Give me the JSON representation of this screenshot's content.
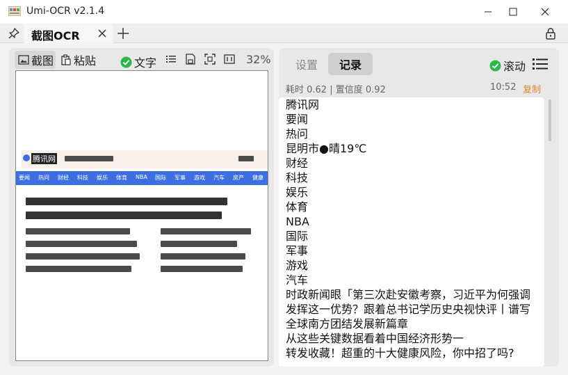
{
  "window": {
    "title": "Umi-OCR v2.1.4",
    "controls": [
      "minimize",
      "maximize",
      "close"
    ]
  },
  "tabs": {
    "items": [
      {
        "label": "截图OCR"
      }
    ],
    "add_icon": "plus-icon",
    "lock_icon": "lock-icon"
  },
  "left": {
    "screenshot_label": "截图",
    "paste_label": "粘贴",
    "text_toggle_label": "文字",
    "text_toggle_checked": true,
    "zoom": "32%",
    "preview": {
      "site": "腾讯网",
      "nav": [
        "要闻",
        "热问",
        "财经",
        "科技",
        "娱乐",
        "体育",
        "NBA",
        "国际",
        "军事",
        "游戏",
        "汽车",
        "房产",
        "健康"
      ]
    }
  },
  "right": {
    "tab_settings": "设置",
    "tab_records": "记录",
    "scroll_label": "滚动",
    "scroll_checked": true,
    "meta": "耗时 0.62 | 置信度 0.92",
    "time": "10:52",
    "copy_label": "复制",
    "lines": [
      "腾讯网",
      "要闻",
      "热问",
      "昆明市●晴19℃",
      "财经",
      "科技",
      "娱乐",
      "体育",
      "NBA",
      "国际",
      "军事",
      "游戏",
      "汽车",
      "时政新闻眼「第三次赴安徽考察，习近平为何强调发挥这一优势？跟着总书记学历史央视快评丨谱写全球南方团结发展新篇章",
      "从这些关键数据看着中国经济形势一",
      "转发收藏！超重的十大健康风险，你中招了吗?"
    ]
  },
  "colors": {
    "accent_green": "#2db64a",
    "copy_orange": "#e08a2a",
    "nav_blue": "#3d6fe0"
  }
}
